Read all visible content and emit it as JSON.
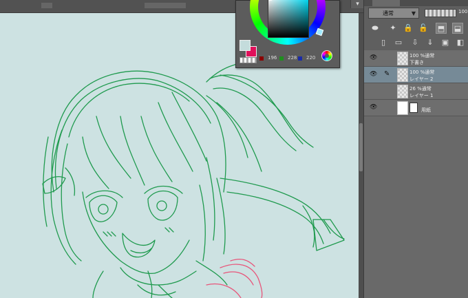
{
  "color_panel": {
    "main_color": "#c4dcdc",
    "sub_color": "#e0105a",
    "channels": [
      {
        "name": "R",
        "value": "196",
        "color": "#8b0000"
      },
      {
        "name": "G",
        "value": "228",
        "color": "#1f8f1f"
      },
      {
        "name": "B",
        "value": "220",
        "color": "#1a2aa8"
      }
    ]
  },
  "layer_panel": {
    "blend_mode": "通常",
    "opacity": "100",
    "layers": [
      {
        "line1": "100 %通常",
        "line2": "下書き"
      },
      {
        "line1": "100 %通常",
        "line2": "レイヤー 2",
        "selected": true
      },
      {
        "line1": "26 %通常",
        "line2": "レイヤー 1"
      },
      {
        "name": "用紙"
      }
    ]
  },
  "canvas": {
    "background": "#cde2e2",
    "sketch_color": "#1f9a4e",
    "accent_color": "#e8557a"
  }
}
